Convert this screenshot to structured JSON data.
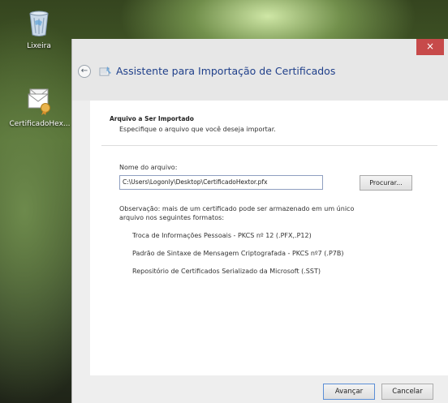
{
  "desktop": {
    "icons": [
      {
        "label": "Lixeira",
        "icon": "recycle-bin-icon"
      },
      {
        "label": "CertificadoHex...",
        "icon": "certificate-file-icon"
      }
    ]
  },
  "window": {
    "close_label": "×",
    "back_glyph": "←",
    "title": "Assistente para Importação de Certificados",
    "accent_color": "#1f3f8a",
    "close_color": "#c74a4a"
  },
  "page": {
    "section_title": "Arquivo a Ser Importado",
    "section_desc": "Especifique o arquivo que você deseja importar.",
    "filename_label": "Nome do arquivo:",
    "filename_value": "C:\\Users\\Logonly\\Desktop\\CertificadoHextor.pfx",
    "browse_label": "Procurar...",
    "note": "Observação: mais de um certificado pode ser armazenado em um único arquivo nos seguintes formatos:",
    "formats": [
      "Troca de Informações Pessoais - PKCS nº 12 (.PFX,.P12)",
      "Padrão de Sintaxe de Mensagem Criptografada - PKCS nº7 (.P7B)",
      "Repositório de Certificados Serializado da Microsoft (.SST)"
    ]
  },
  "footer": {
    "next_label": "Avançar",
    "cancel_label": "Cancelar"
  }
}
